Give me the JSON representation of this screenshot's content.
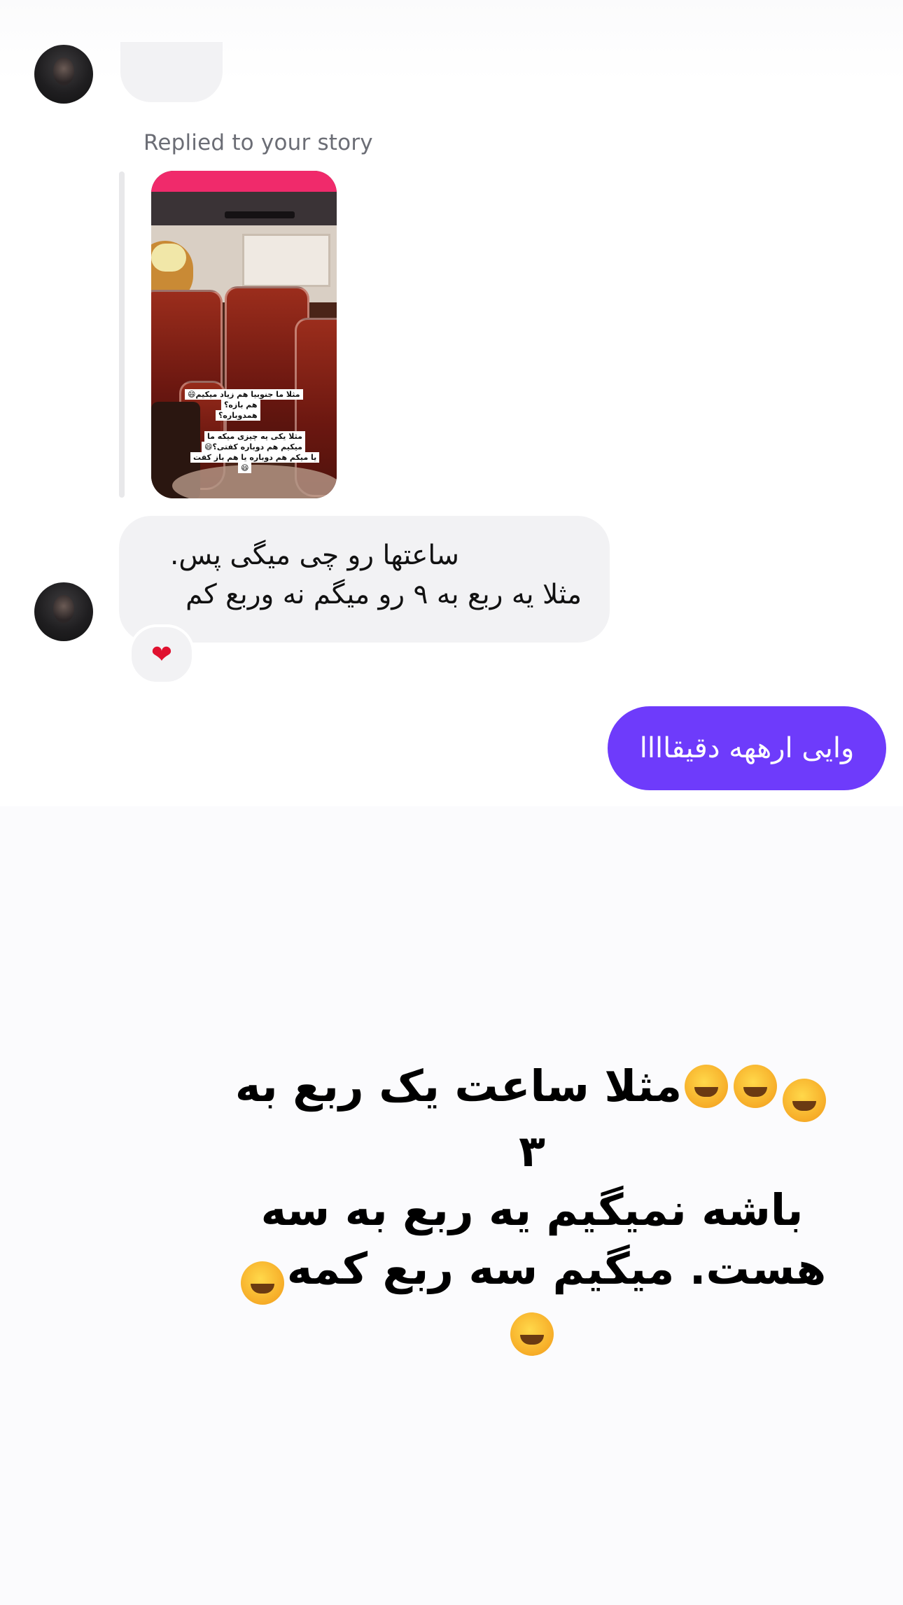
{
  "thread": {
    "replied_label": "Replied to your story",
    "story_captions": [
      "مثلا ما جنوبیا هم زیاد میکیم😄",
      "هم بازه؟",
      "همدوباره؟",
      "مثلا یکی یه چیزی میکه ما",
      "میکیم هم دوباره کفتی؟😄",
      "یا میکم هم دوباره یا هم باز کفت",
      "😄"
    ],
    "incoming_message": {
      "line1": "ساعتها رو چی میگی پس.",
      "line2": "مثلا یه ربع به ۹ رو میگم نه وربع کم",
      "reaction": "❤"
    },
    "outgoing_message": "وایی ارههه دقیقاااا"
  },
  "overlay": {
    "line1_emoji": "🤣🤣🤣",
    "line1_text": "مثلا ساعت یک ربع به ۳",
    "line2_text": "باشه نمیگیم یه ربع به سه",
    "line3_text": "هست. میگیم سه ربع کمه",
    "line3_emoji": "🤣🤣"
  },
  "colors": {
    "outgoing_bubble": "#6e3bfb",
    "incoming_bubble": "#f2f2f4",
    "reaction_heart": "#e0112f"
  }
}
